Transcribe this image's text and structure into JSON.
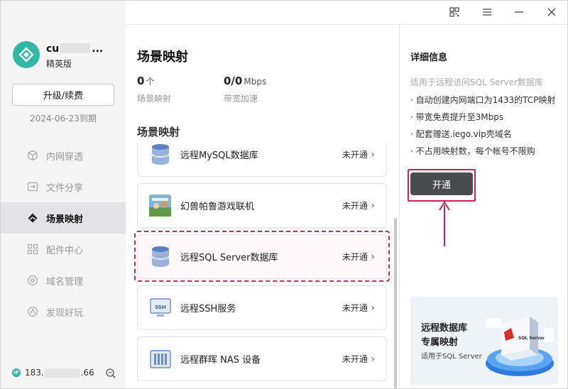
{
  "sidebar": {
    "username_start": "cu",
    "username_end": "...",
    "edition": "精英版",
    "upgrade_label": "升级/续费",
    "expiry": "2024-06-23到期",
    "items": [
      {
        "label": "内网穿透",
        "icon": "cube-icon"
      },
      {
        "label": "文件分享",
        "icon": "file-share-icon"
      },
      {
        "label": "场景映射",
        "icon": "scene-icon",
        "active": true
      },
      {
        "label": "配件中心",
        "icon": "grid-icon"
      },
      {
        "label": "域名管理",
        "icon": "globe-icon"
      },
      {
        "label": "发现好玩",
        "icon": "discover-icon"
      }
    ],
    "ip_badge": "IP",
    "ip_start": "183.",
    "ip_end": ".66"
  },
  "main": {
    "title": "场景映射",
    "stats": [
      {
        "value": "0",
        "unit": "个",
        "label": "场景映射"
      },
      {
        "value": "0/0",
        "unit": "Mbps",
        "label": "带宽加速"
      }
    ],
    "section_title": "场景映射",
    "cards": [
      {
        "name": "远程MySQL数据库",
        "status": "未开通"
      },
      {
        "name": "幻兽帕鲁游戏联机",
        "status": "未开通"
      },
      {
        "name": "远程SQL Server数据库",
        "status": "未开通"
      },
      {
        "name": "远程SSH服务",
        "status": "未开通"
      },
      {
        "name": "远程群晖 NAS 设备",
        "status": "未开通"
      }
    ]
  },
  "detail": {
    "title": "详细信息",
    "desc": "适用于远程访问SQL Server数据库",
    "features": [
      "· 自动创建内网端口为1433的TCP映射",
      "· 带宽免费提升至3Mbps",
      "· 配套赠送.iego.vip壳域名",
      "· 不占用映射数，每个帐号不限购"
    ],
    "open_label": "开通",
    "banner": {
      "line1": "远程数据库",
      "line2": "专属映射",
      "line3": "适用于SQL Server",
      "tag": "SQL Server"
    }
  },
  "colors": {
    "accent": "#2fb8a3",
    "highlight": "#d21f55",
    "button": "#4a4b4f"
  }
}
